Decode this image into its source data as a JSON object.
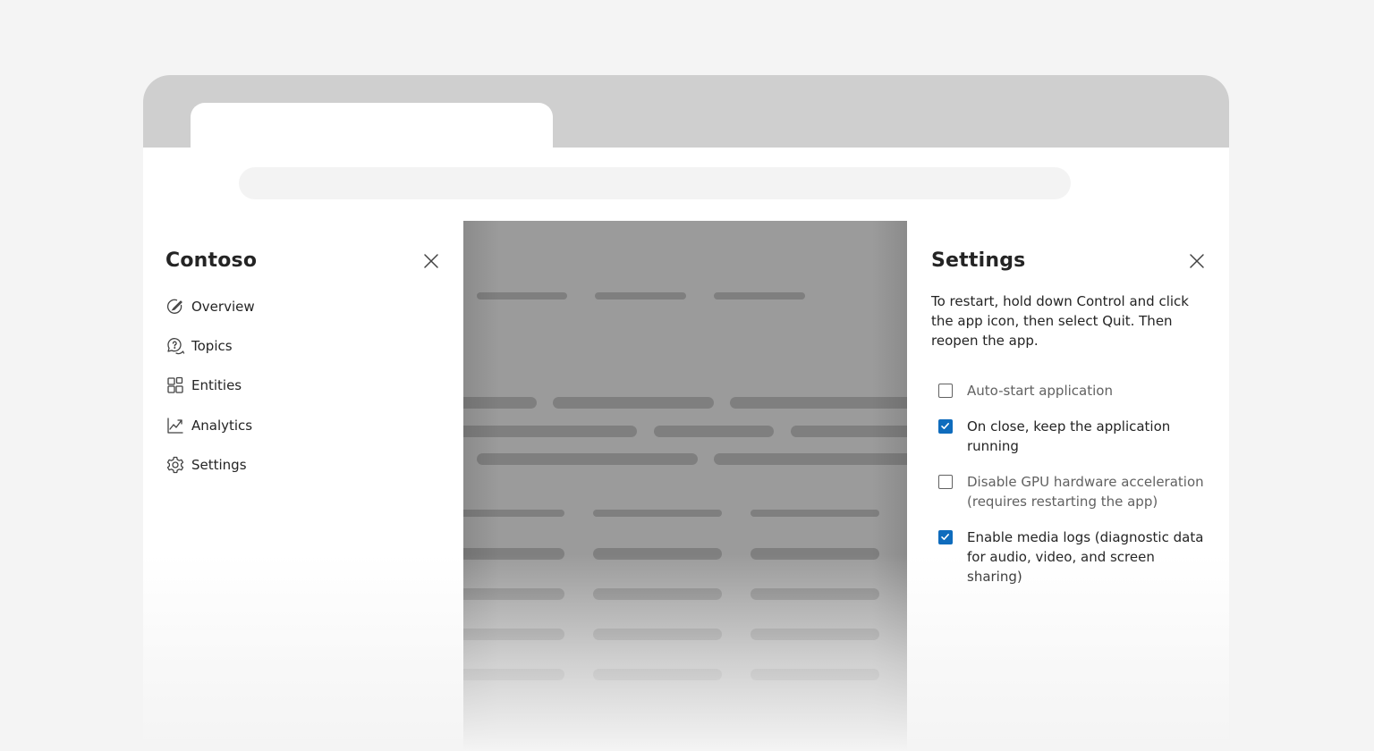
{
  "left_panel": {
    "title": "Contoso",
    "close_icon": "dismiss-icon",
    "nav_items": [
      {
        "label": "Overview",
        "icon": "overview-icon"
      },
      {
        "label": "Topics",
        "icon": "topics-icon"
      },
      {
        "label": "Entities",
        "icon": "entities-icon"
      },
      {
        "label": "Analytics",
        "icon": "analytics-icon"
      },
      {
        "label": "Settings",
        "icon": "settings-icon"
      }
    ]
  },
  "settings_panel": {
    "title": "Settings",
    "close_icon": "dismiss-icon",
    "description": "To restart, hold down Control and click the app icon, then select Quit. Then reopen the app.",
    "options": [
      {
        "label": "Auto-start application",
        "checked": false
      },
      {
        "label": "On close, keep the application running",
        "checked": true
      },
      {
        "label": "Disable GPU hardware acceleration (requires restarting the app)",
        "checked": false
      },
      {
        "label": "Enable media logs (diagnostic data for audio, video, and screen sharing)",
        "checked": true
      }
    ]
  },
  "colors": {
    "accent": "#0f6cbd",
    "overlay": "#9b9b9b",
    "tab_strip": "#cfcfcf",
    "page_background": "#f4f4f4"
  }
}
